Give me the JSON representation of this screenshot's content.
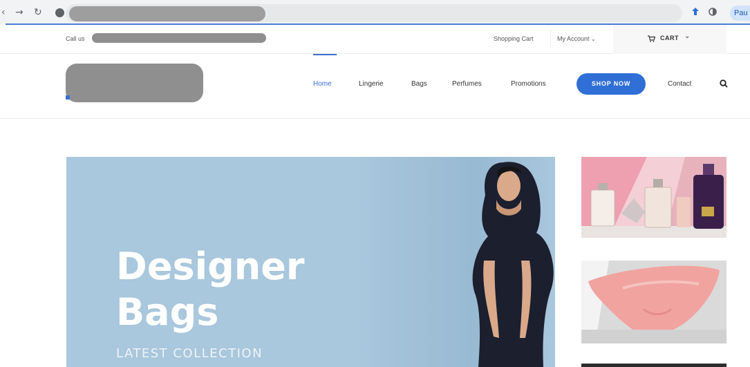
{
  "browser": {
    "back_icon": "back-arrow-icon",
    "forward_icon": "forward-arrow-icon",
    "reload_icon": "reload-icon",
    "profile_label": "Pau"
  },
  "topbar": {
    "callus_label": "Call us",
    "shopping_cart": "Shopping Cart",
    "my_account": "My Account",
    "cart": "CART"
  },
  "nav": {
    "items": [
      "Home",
      "Lingerie",
      "Bags",
      "Perfumes",
      "Promotions"
    ],
    "shop_now": "SHOP NOW",
    "contact": "Contact"
  },
  "hero": {
    "title_line1": "Designer",
    "title_line2": "Bags",
    "subtitle": "LATEST COLLECTION"
  },
  "colors": {
    "accent": "#2f6fd6",
    "hero_bg": "#a9c7dd"
  }
}
